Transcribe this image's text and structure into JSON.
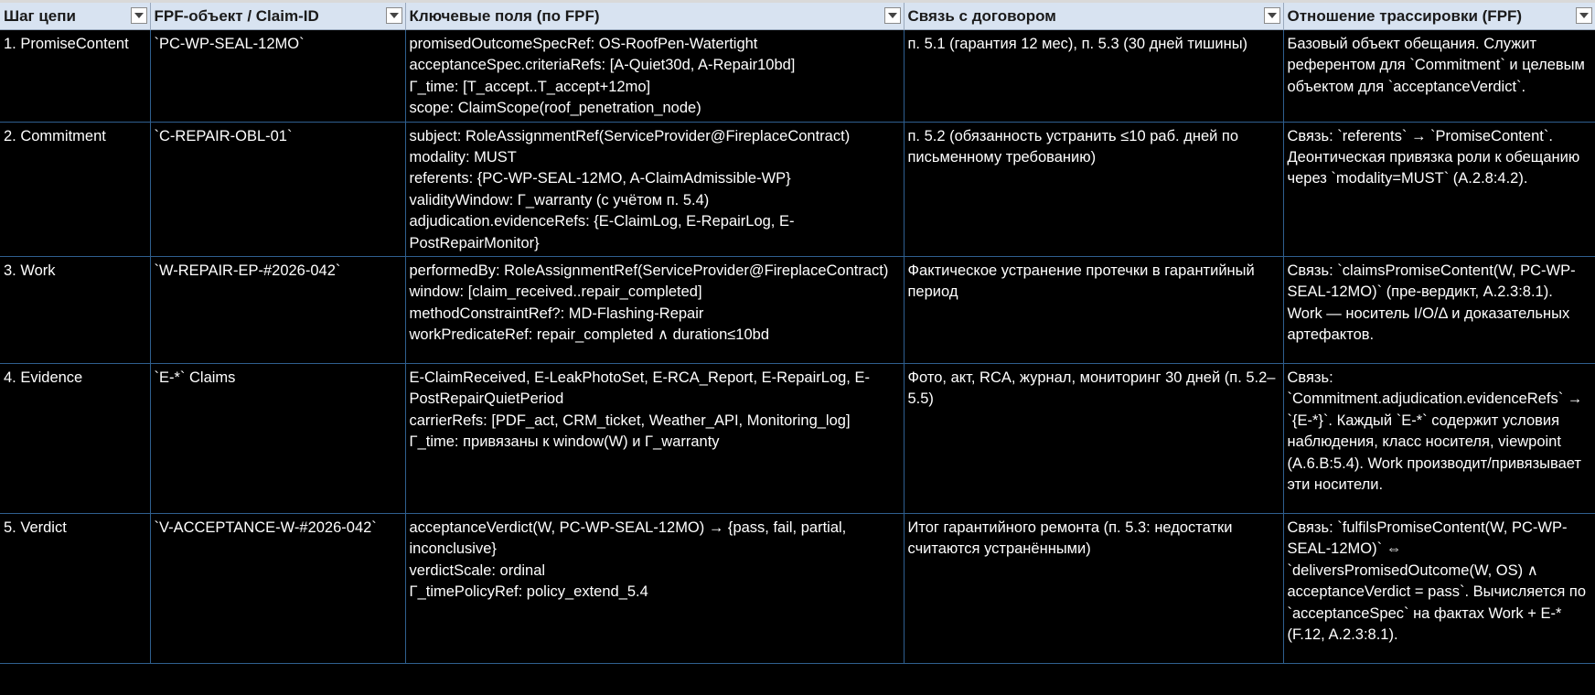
{
  "headers": [
    "Шаг цепи",
    "FPF-объект / Claim-ID",
    "Ключевые поля (по FPF)",
    "Связь с договором",
    "Отношение трассировки (FPF)"
  ],
  "rows": [
    {
      "step": "1. PromiseContent",
      "id": "`PC-WP-SEAL-12MO`",
      "fields": [
        "promisedOutcomeSpecRef: OS-RoofPen-Watertight",
        "acceptanceSpec.criteriaRefs: [A-Quiet30d, A-Repair10bd]",
        "Γ_time: [T_accept..T_accept+12mo]",
        "scope: ClaimScope(roof_penetration_node)"
      ],
      "contract": "п. 5.1 (гарантия 12 мес), п. 5.3 (30 дней тишины)",
      "trace": "Базовый объект обещания. Служит референтом для `Commitment` и целевым объектом для `acceptanceVerdict`."
    },
    {
      "step": "2. Commitment",
      "id": "`C-REPAIR-OBL-01`",
      "fields": [
        "subject: RoleAssignmentRef(ServiceProvider@FireplaceContract)",
        "modality: MUST",
        "referents: {PC-WP-SEAL-12MO, A-ClaimAdmissible-WP}",
        "validityWindow: Γ_warranty (с учётом п. 5.4)",
        "adjudication.evidenceRefs: {E-ClaimLog, E-RepairLog, E-PostRepairMonitor}"
      ],
      "contract": "п. 5.2 (обязанность устранить ≤10 раб. дней по письменному требованию)",
      "trace": "Связь: `referents` → `PromiseContent`. Деонтическая привязка роли к обещанию через `modality=MUST` (A.2.8:4.2)."
    },
    {
      "step": "3. Work",
      "id": "`W-REPAIR-EP-#2026-042`",
      "fields": [
        "performedBy: RoleAssignmentRef(ServiceProvider@FireplaceContract)",
        "window: [claim_received..repair_completed]",
        "methodConstraintRef?: MD-Flashing-Repair",
        "workPredicateRef: repair_completed ∧ duration≤10bd"
      ],
      "contract": "Фактическое устранение протечки в гарантийный период",
      "trace": "Связь: `claimsPromiseContent(W, PC-WP-SEAL-12MO)` (пре-вердикт, A.2.3:8.1). Work — носитель I/O/Δ и доказательных артефактов."
    },
    {
      "step": "4. Evidence",
      "id": "`E-*` Claims",
      "fields": [
        "E-ClaimReceived, E-LeakPhotoSet, E-RCA_Report, E-RepairLog, E-PostRepairQuietPeriod",
        "carrierRefs:  [PDF_act, CRM_ticket, Weather_API, Monitoring_log]",
        "Γ_time: привязаны к window(W) и Γ_warranty"
      ],
      "contract": "Фото, акт, RCA, журнал, мониторинг 30 дней (п. 5.2–5.5)",
      "trace": "Связь: `Commitment.adjudication.evidenceRefs` → `{E-*}`. Каждый `E-*` содержит условия наблюдения, класс носителя, viewpoint (A.6.B:5.4). Work производит/привязывает эти носители."
    },
    {
      "step": "5. Verdict",
      "id": "`V-ACCEPTANCE-W-#2026-042`",
      "fields": [
        "acceptanceVerdict(W, PC-WP-SEAL-12MO) → {pass, fail, partial, inconclusive}",
        "verdictScale: ordinal",
        "Γ_timePolicyRef: policy_extend_5.4"
      ],
      "contract": "Итог гарантийного ремонта (п. 5.3: недостатки считаются устранёнными)",
      "trace": "Связь: `fulfilsPromiseContent(W, PC-WP-SEAL-12MO)` ⇔ `deliversPromisedOutcome(W, OS) ∧ acceptanceVerdict = pass`. Вычисляется по `acceptanceSpec` на фактах Work + E-* (F.12, A.2.3:8.1)."
    }
  ]
}
